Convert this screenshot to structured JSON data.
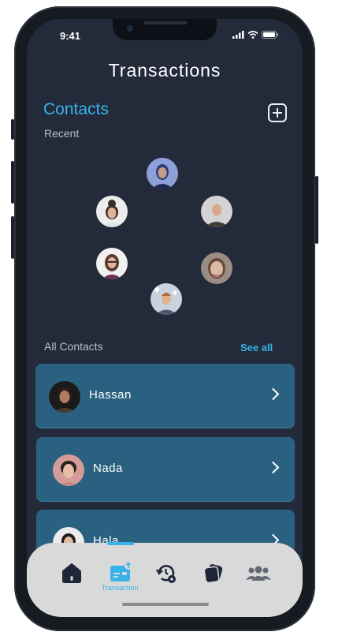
{
  "status_bar": {
    "time": "9:41"
  },
  "header": {
    "title": "Transactions"
  },
  "contacts": {
    "heading": "Contacts",
    "recent_label": "Recent",
    "add_icon": "plus-square-icon",
    "recent_avatars": [
      {
        "name": "recent-contact-1"
      },
      {
        "name": "recent-contact-2"
      },
      {
        "name": "recent-contact-3"
      },
      {
        "name": "recent-contact-4"
      },
      {
        "name": "recent-contact-5"
      },
      {
        "name": "recent-contact-6"
      }
    ]
  },
  "all_contacts": {
    "label": "All Contacts",
    "see_all": "See all",
    "items": [
      {
        "name": "Hassan"
      },
      {
        "name": "Nada"
      },
      {
        "name": "Hala"
      }
    ]
  },
  "tabbar": {
    "tabs": [
      {
        "icon": "home-icon"
      },
      {
        "icon": "transaction-card-icon",
        "label": "Transaction",
        "active": true
      },
      {
        "icon": "history-settings-icon"
      },
      {
        "icon": "cards-icon"
      },
      {
        "icon": "group-icon"
      }
    ]
  },
  "colors": {
    "accent": "#38b3ea",
    "background": "#232a3a",
    "card": "#2b6180",
    "tabbar": "#d9d9d9"
  }
}
